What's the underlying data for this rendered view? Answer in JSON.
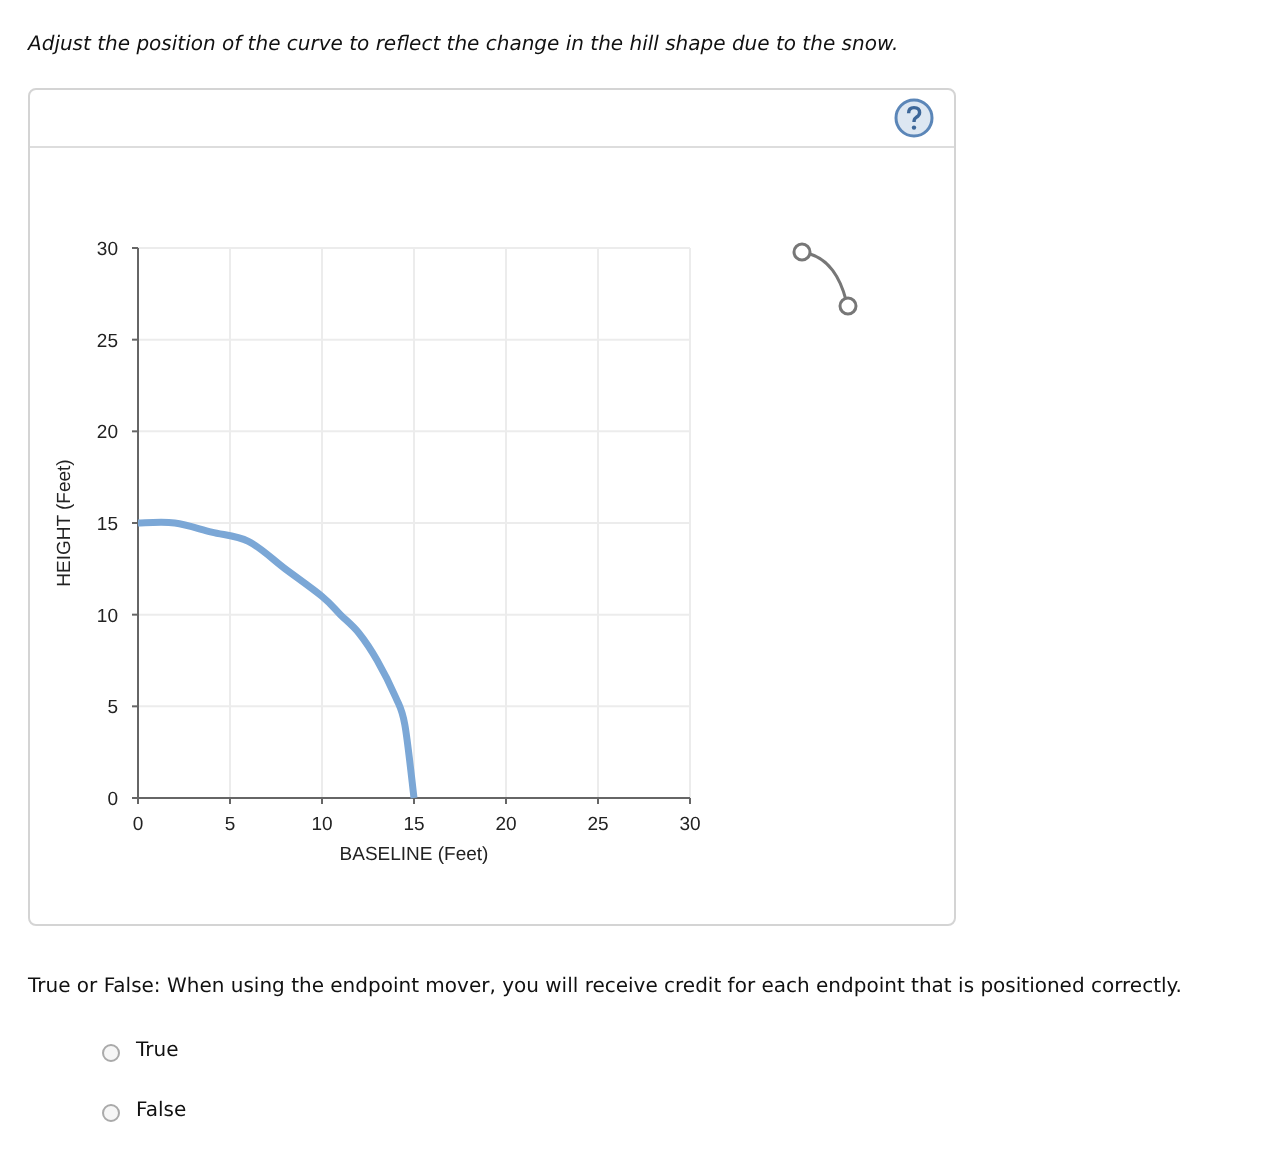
{
  "instruction": "Adjust the position of the curve to reflect the change in the hill shape due to the snow.",
  "graph": {
    "chart_data": {
      "type": "line",
      "xlabel": "BASELINE (Feet)",
      "ylabel": "HEIGHT (Feet)",
      "xlim": [
        0,
        30
      ],
      "ylim": [
        0,
        30
      ],
      "xticks": [
        0,
        5,
        10,
        15,
        20,
        25,
        30
      ],
      "yticks": [
        0,
        5,
        10,
        15,
        20,
        25,
        30
      ],
      "grid": true,
      "x": [
        0,
        2,
        4,
        6,
        8,
        10,
        11,
        12,
        13,
        14,
        14.5,
        15
      ],
      "series": [
        {
          "color": "#7ba7d6",
          "values": [
            15,
            15,
            14.5,
            14,
            12.5,
            11,
            10,
            9,
            7.5,
            5.5,
            4,
            0
          ]
        }
      ]
    }
  },
  "question": "True or False: When using the endpoint mover, you will receive credit for each endpoint that is positioned correctly.",
  "options": [
    {
      "label": "True",
      "selected": false
    },
    {
      "label": "False",
      "selected": false
    }
  ]
}
